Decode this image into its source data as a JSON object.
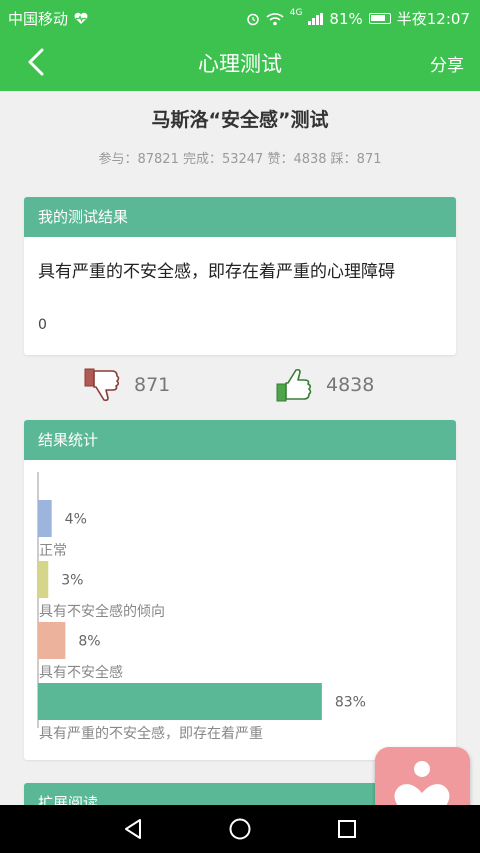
{
  "status_bar": {
    "carrier": "中国移动",
    "signal_tag": "4G",
    "battery": "81%",
    "time": "半夜12:07"
  },
  "appbar": {
    "title": "心理测试",
    "share_label": "分享"
  },
  "test": {
    "title": "马斯洛“安全感”测试",
    "stats": "参与：87821 完成：53247 赞：4838 踩：871"
  },
  "result": {
    "header": "我的测试结果",
    "text": "具有严重的不安全感，即存在着严重的心理障碍",
    "score": "0"
  },
  "votes": {
    "down_count": "871",
    "up_count": "4838"
  },
  "statistics": {
    "header": "结果统计"
  },
  "more": {
    "header": "扩展阅读"
  },
  "colors": {
    "green": "#3ec24f",
    "card_header": "#5bb897",
    "fab": "#f19a9e"
  },
  "chart_data": {
    "type": "bar",
    "orientation": "horizontal",
    "categories": [
      "正常",
      "具有不安全感的倾向",
      "具有不安全感",
      "具有严重的不安全感，即存在着严重"
    ],
    "values": [
      4,
      3,
      8,
      83
    ],
    "value_labels": [
      "4%",
      "3%",
      "8%",
      "83%"
    ],
    "colors": [
      "#9db5dc",
      "#d6d68a",
      "#edb29c",
      "#5bb897"
    ],
    "unit": "%",
    "xlim": [
      0,
      100
    ]
  }
}
